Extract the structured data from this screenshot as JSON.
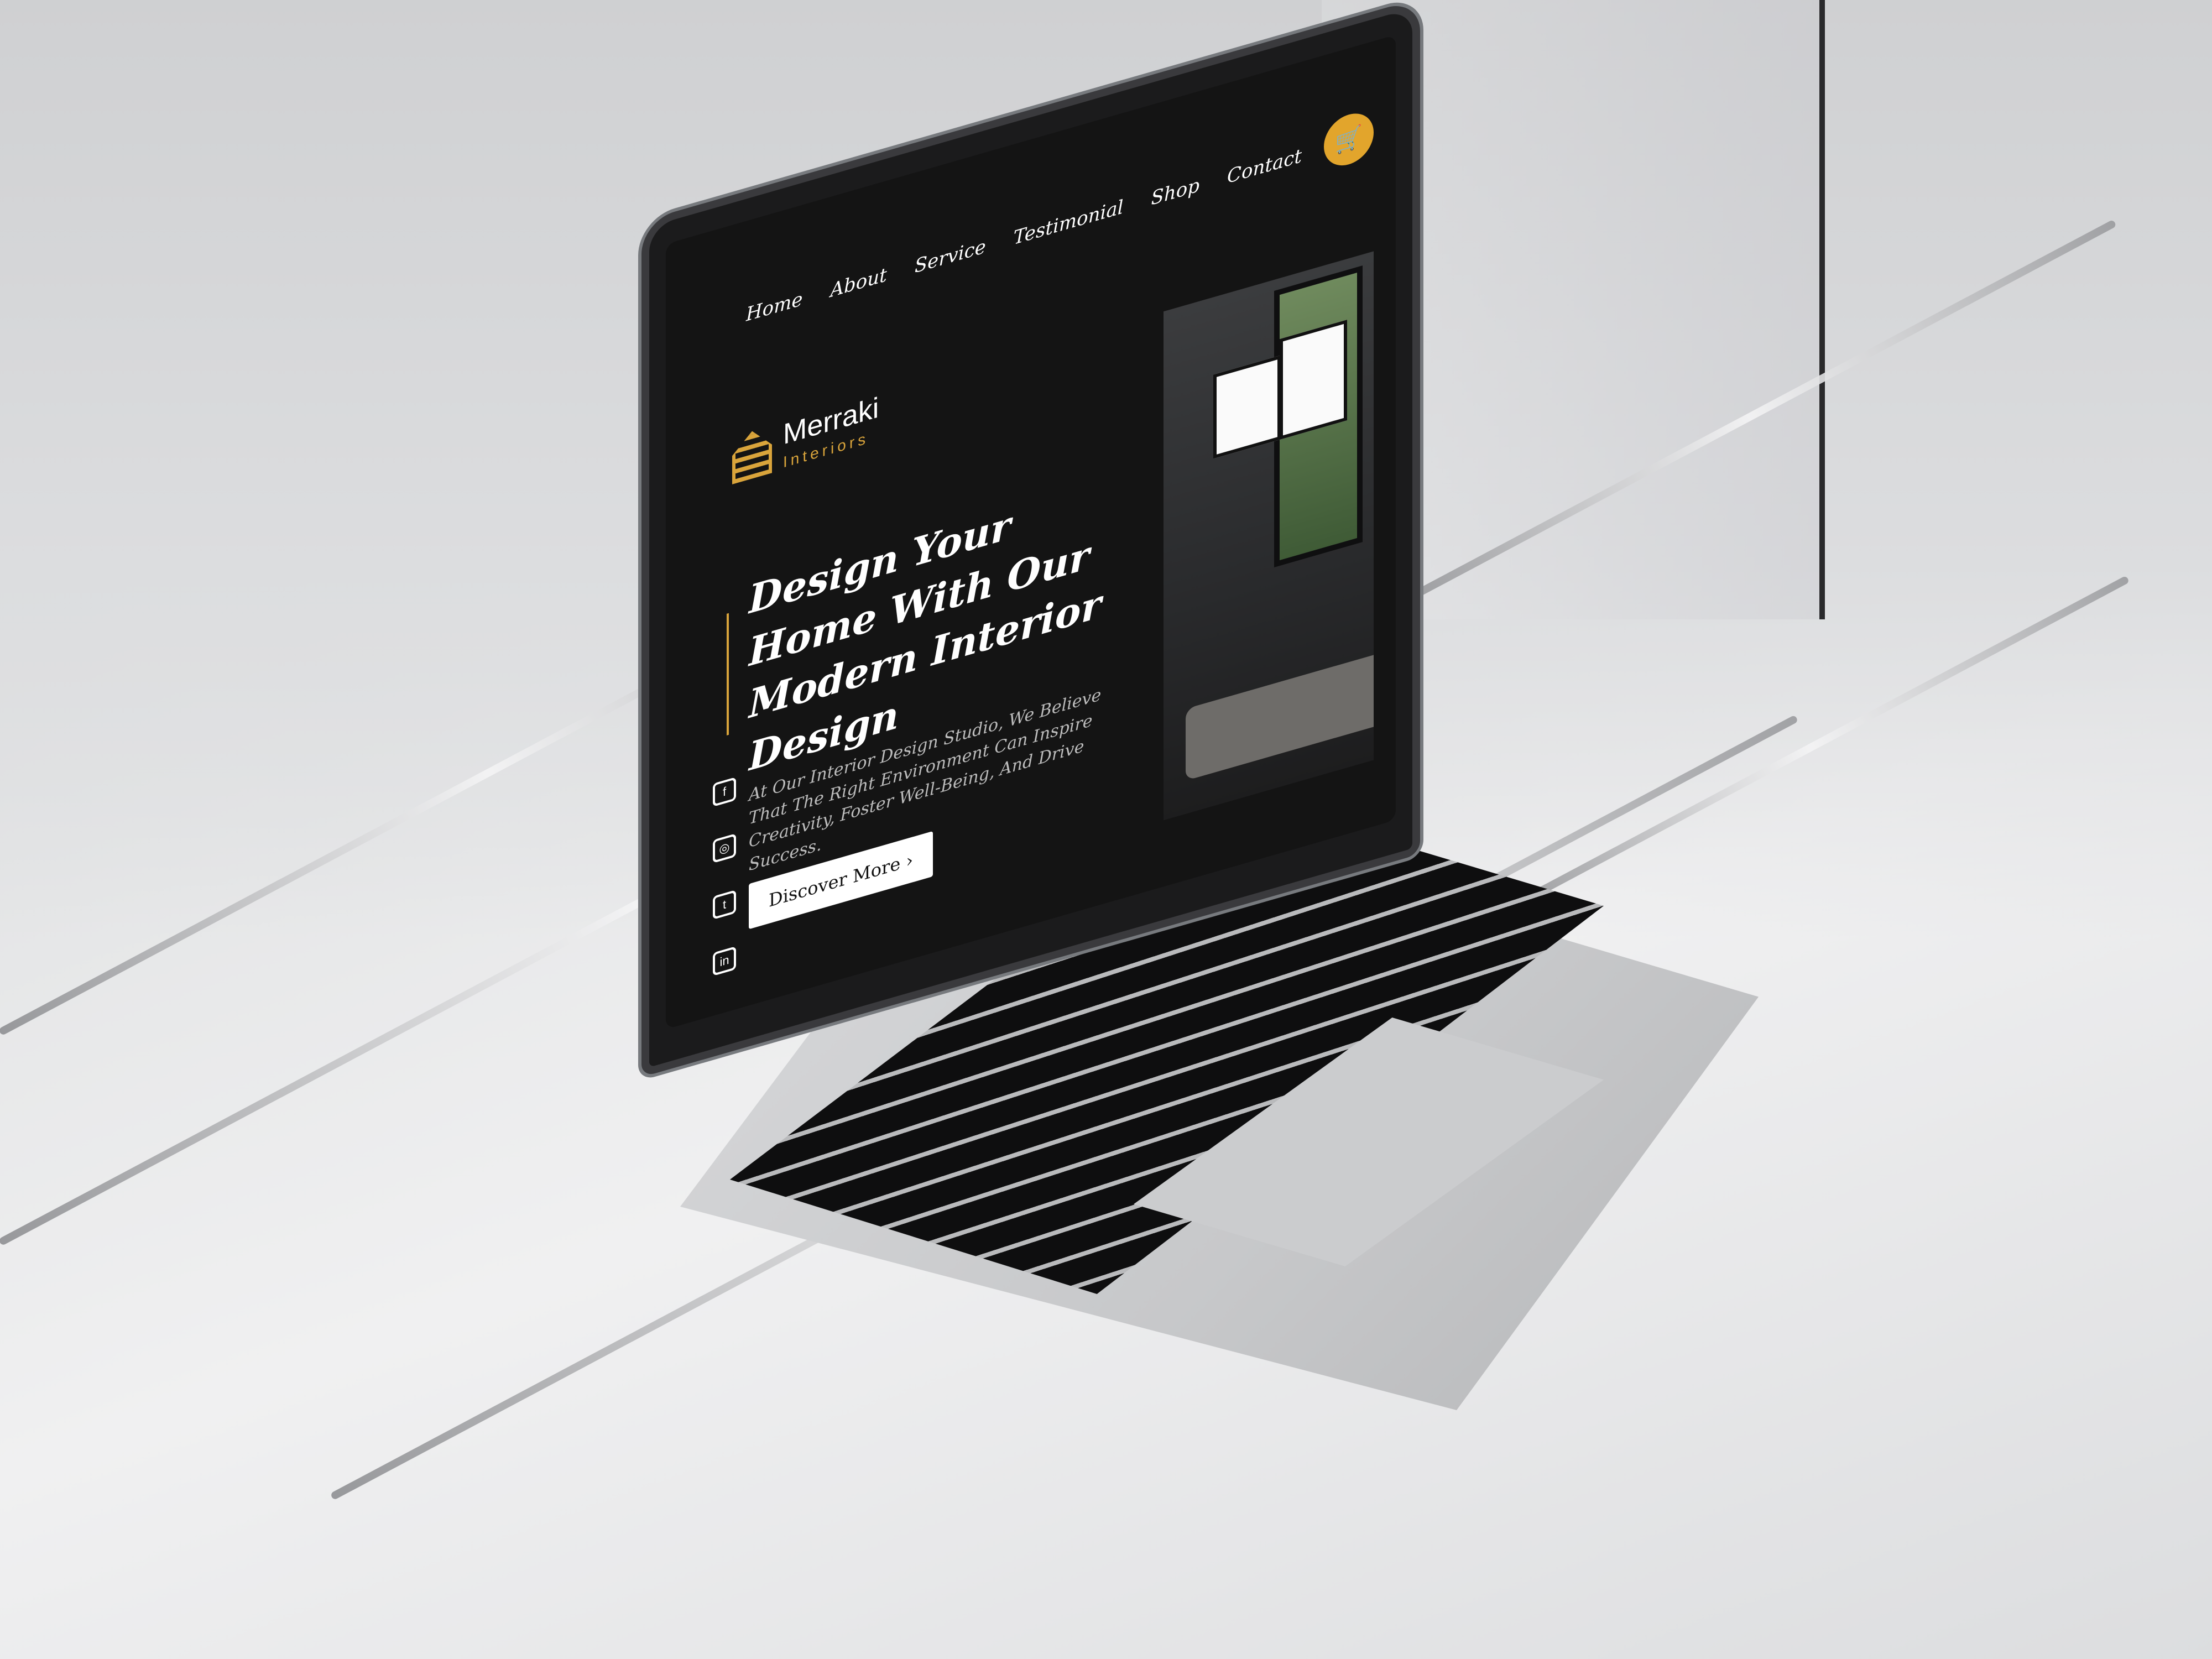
{
  "site": {
    "brand_name": "Merraki",
    "brand_sub": "Interiors",
    "nav": [
      "Home",
      "About",
      "Service",
      "Testimonial",
      "Shop",
      "Contact"
    ],
    "cart_icon": "cart-icon",
    "hero_title": "Design Your Home With Our Modern Interior Design",
    "hero_desc": "At Our Interior Design Studio, We Believe That The Right Environment Can Inspire Creativity, Foster Well-Being, And Drive Success.",
    "cta_label": "Discover More",
    "cta_icon": "chevron-right-icon",
    "social_icons": [
      "facebook-icon",
      "instagram-icon",
      "twitter-icon",
      "linkedin-icon"
    ],
    "accent_color": "#d9a43b",
    "background_color": "#141414"
  }
}
